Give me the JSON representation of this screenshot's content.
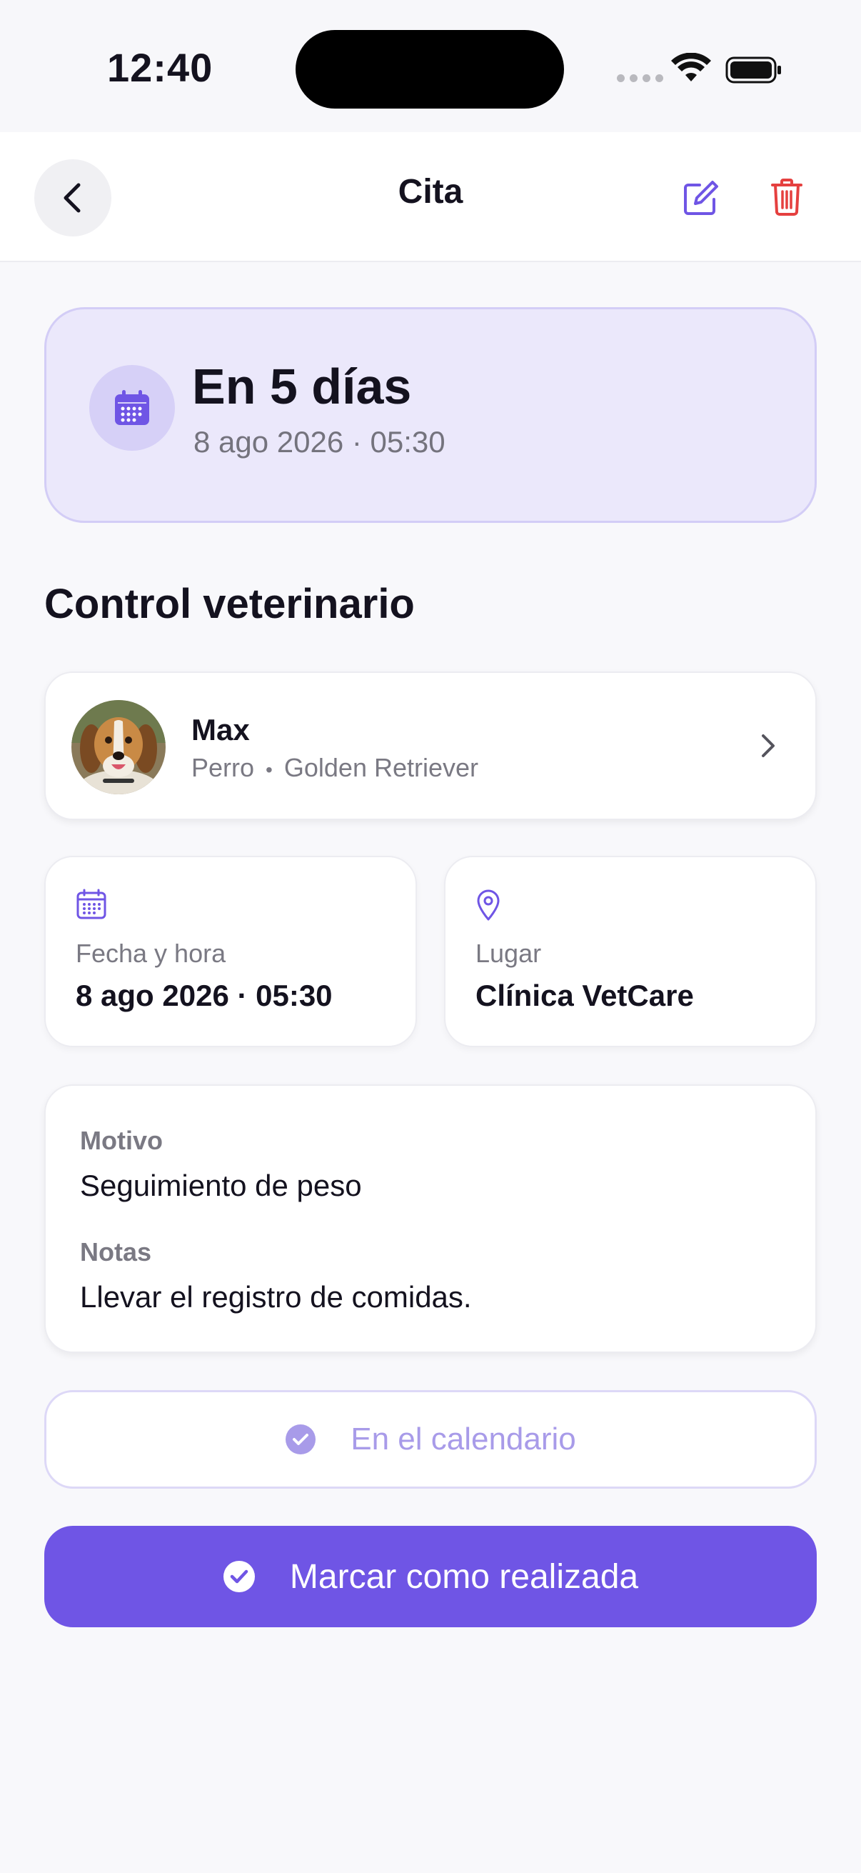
{
  "status_bar": {
    "time": "12:40"
  },
  "nav": {
    "title": "Cita"
  },
  "hero": {
    "title": "En 5 días",
    "subtitle": "8 ago 2026 · 05:30"
  },
  "section_title": "Control veterinario",
  "pet": {
    "name": "Max",
    "species": "Perro",
    "breed": "Golden Retriever",
    "separator": "•"
  },
  "info": {
    "datetime": {
      "label": "Fecha y hora",
      "value": "8 ago 2026 · 05:30"
    },
    "place": {
      "label": "Lugar",
      "value": "Clínica VetCare"
    }
  },
  "details": {
    "reason_label": "Motivo",
    "reason_value": "Seguimiento de peso",
    "notes_label": "Notas",
    "notes_value": "Llevar el registro de comidas."
  },
  "calendar_button": {
    "label": "En el calendario",
    "state": "disabled"
  },
  "primary_button": {
    "label": "Marcar como realizada"
  },
  "icons": {
    "back": "chevron-left-icon",
    "edit": "edit-icon",
    "delete": "trash-icon",
    "calendar": "calendar-icon",
    "location": "location-pin-icon",
    "check": "check-circle-icon",
    "chevron": "chevron-right-icon"
  },
  "colors": {
    "accent": "#6f55e5",
    "accent_light": "#ebe8fb",
    "danger": "#e5403f",
    "text_primary": "#14121f",
    "text_secondary": "#7a7983",
    "background": "#f8f8fb"
  }
}
